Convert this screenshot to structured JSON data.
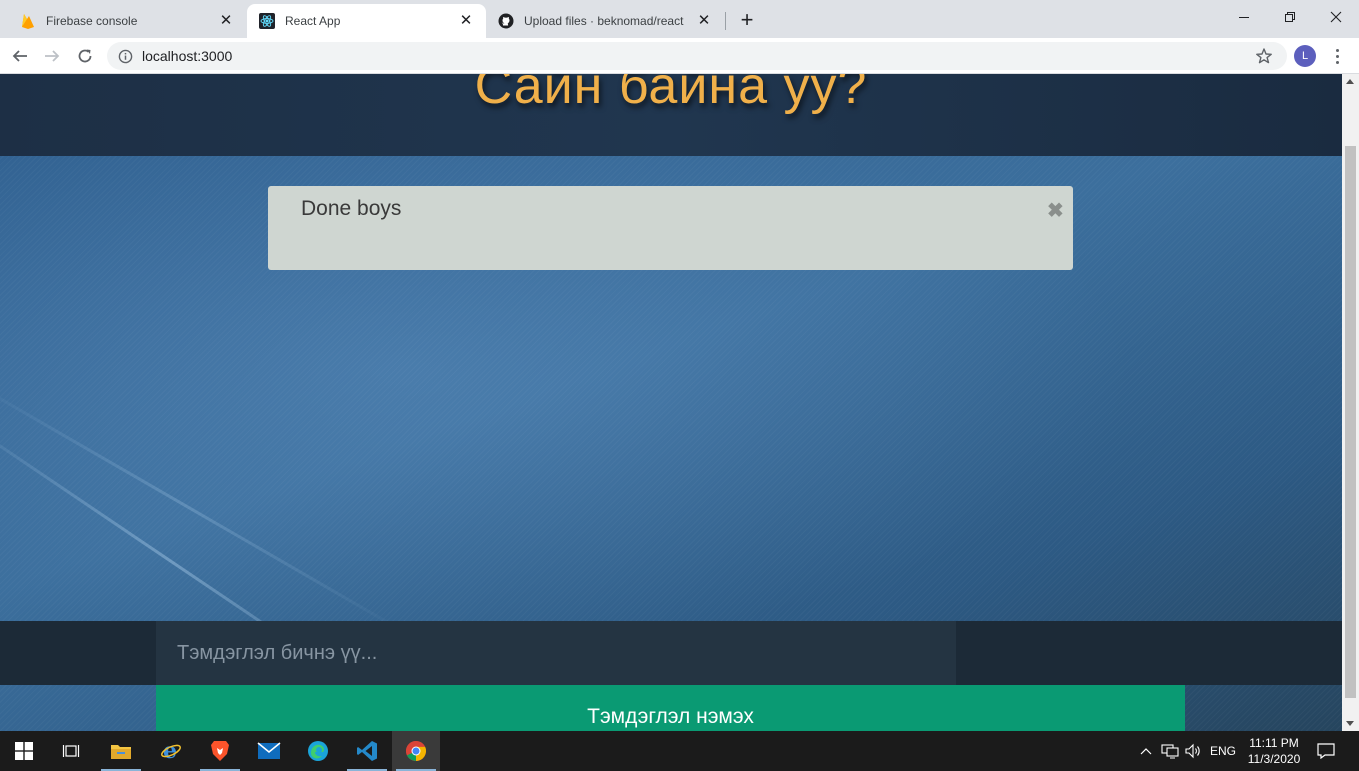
{
  "browser": {
    "tabs": [
      {
        "title": "Firebase console",
        "icon": "firebase-icon",
        "active": false
      },
      {
        "title": "React App",
        "icon": "react-icon",
        "active": true
      },
      {
        "title": "Upload files · beknomad/react",
        "icon": "github-icon",
        "active": false
      }
    ],
    "url": "localhost:3000",
    "profile_initial": "L"
  },
  "page": {
    "heading": "Сайн байна уу?",
    "notes": [
      {
        "text": "Done boys"
      }
    ],
    "input_placeholder": "Тэмдэглэл бичнэ үү...",
    "add_button_label": "Тэмдэглэл нэмэх"
  },
  "taskbar": {
    "apps": [
      "start-icon",
      "task-view-icon",
      "file-explorer-icon",
      "internet-explorer-icon",
      "brave-icon",
      "mail-icon",
      "edge-icon",
      "vscode-icon",
      "chrome-icon"
    ],
    "language": "ENG",
    "time": "11:11 PM",
    "date": "11/3/2020"
  },
  "colors": {
    "heading": "#f0b04a",
    "note_bg": "#cfd6d1",
    "add_button": "#0a9a73"
  }
}
